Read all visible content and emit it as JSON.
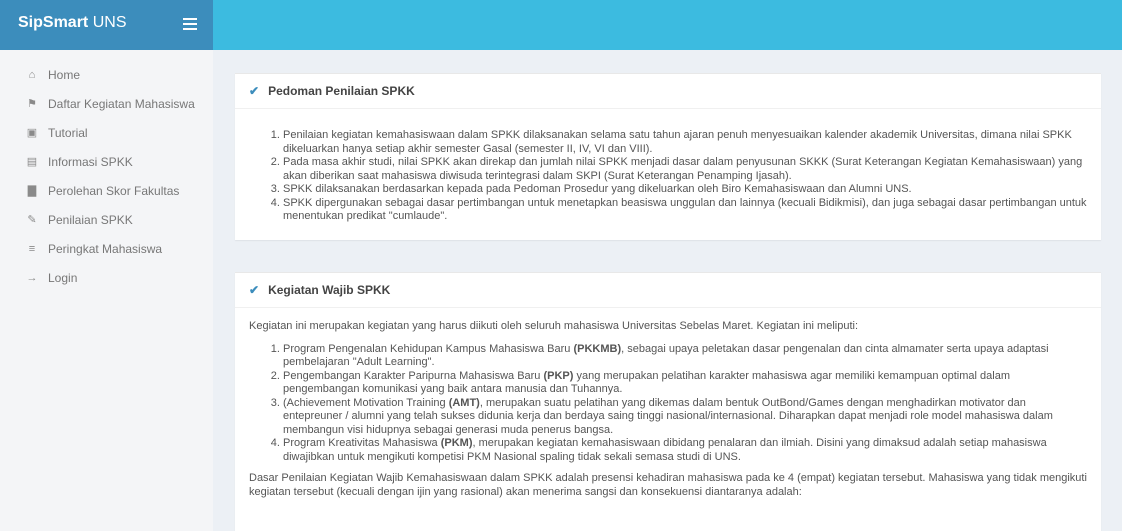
{
  "brand": {
    "bold": "SipSmart",
    "light": "UNS"
  },
  "menu": [
    {
      "icon": "home-icon",
      "glyph": "⌂",
      "label": "Home"
    },
    {
      "icon": "trophy-icon",
      "glyph": "⚑",
      "label": "Daftar Kegiatan Mahasiswa"
    },
    {
      "icon": "video-icon",
      "glyph": "▣",
      "label": "Tutorial"
    },
    {
      "icon": "newspaper-icon",
      "glyph": "▤",
      "label": "Informasi SPKK"
    },
    {
      "icon": "bar-chart-icon",
      "glyph": "▇",
      "label": "Perolehan Skor Fakultas"
    },
    {
      "icon": "edit-icon",
      "glyph": "✎",
      "label": "Penilaian SPKK"
    },
    {
      "icon": "list-icon",
      "glyph": "≡",
      "label": "Peringkat Mahasiswa"
    },
    {
      "icon": "login-icon",
      "glyph": "→",
      "label": "Login"
    }
  ],
  "box1": {
    "title": "Pedoman Penilaian SPKK",
    "items": [
      "Penilaian kegiatan kemahasiswaan dalam SPKK dilaksanakan selama satu tahun ajaran penuh menyesuaikan kalender akademik Universitas, dimana nilai SPKK dikeluarkan hanya setiap akhir semester Gasal (semester II, IV, VI dan VIII).",
      "Pada masa akhir studi, nilai SPKK akan direkap dan jumlah nilai SPKK menjadi dasar dalam penyusunan SKKK (Surat Keterangan Kegiatan Kemahasiswaan) yang akan diberikan saat mahasiswa diwisuda terintegrasi dalam SKPI (Surat Keterangan Penamping Ijasah).",
      "SPKK dilaksanakan berdasarkan kepada pada Pedoman Prosedur yang dikeluarkan oleh Biro Kemahasiswaan dan Alumni UNS.",
      "SPKK dipergunakan sebagai dasar pertimbangan untuk menetapkan beasiswa unggulan dan lainnya (kecuali Bidikmisi), dan juga sebagai dasar pertimbangan untuk menentukan predikat \"cumlaude\"."
    ]
  },
  "box2": {
    "title": "Kegiatan Wajib SPKK",
    "intro": "Kegiatan ini merupakan kegiatan yang harus diikuti oleh seluruh mahasiswa Universitas Sebelas Maret. Kegiatan ini meliputi:",
    "items": [
      {
        "a": "Program Pengenalan Kehidupan Kampus Mahasiswa Baru ",
        "b": "(PKKMB)",
        "c": ", sebagai upaya peletakan dasar pengenalan dan cinta almamater serta upaya adaptasi pembelajaran \"Adult Learning\"."
      },
      {
        "a": "Pengembangan Karakter Paripurna Mahasiswa Baru ",
        "b": "(PKP)",
        "c": " yang merupakan pelatihan karakter mahasiswa agar memiliki kemampuan optimal dalam pengembangan komunikasi yang baik antara manusia dan Tuhannya."
      },
      {
        "a": "(Achievement Motivation Training ",
        "b": "(AMT)",
        "c": ", merupakan suatu pelatihan yang dikemas dalam bentuk OutBond/Games dengan menghadirkan motivator dan entepreuner / alumni yang telah sukses didunia kerja dan berdaya saing tinggi nasional/internasional. Diharapkan dapat menjadi role model mahasiswa dalam membangun visi hidupnya sebagai generasi muda penerus bangsa."
      },
      {
        "a": "Program Kreativitas Mahasiswa ",
        "b": "(PKM)",
        "c": ", merupakan kegiatan kemahasiswaan dibidang penalaran dan ilmiah. Disini yang dimaksud adalah setiap mahasiswa diwajibkan untuk mengikuti kompetisi PKM Nasional spaling tidak sekali semasa studi di UNS."
      }
    ],
    "dasar": "Dasar Penilaian Kegiatan Wajib Kemahasiswaan dalam SPKK adalah presensi kehadiran mahasiswa pada ke 4 (empat) kegiatan tersebut. Mahasiswa yang tidak mengikuti kegiatan tersebut (kecuali dengan ijin yang rasional) akan menerima sangsi dan konsekuensi diantaranya adalah:"
  }
}
